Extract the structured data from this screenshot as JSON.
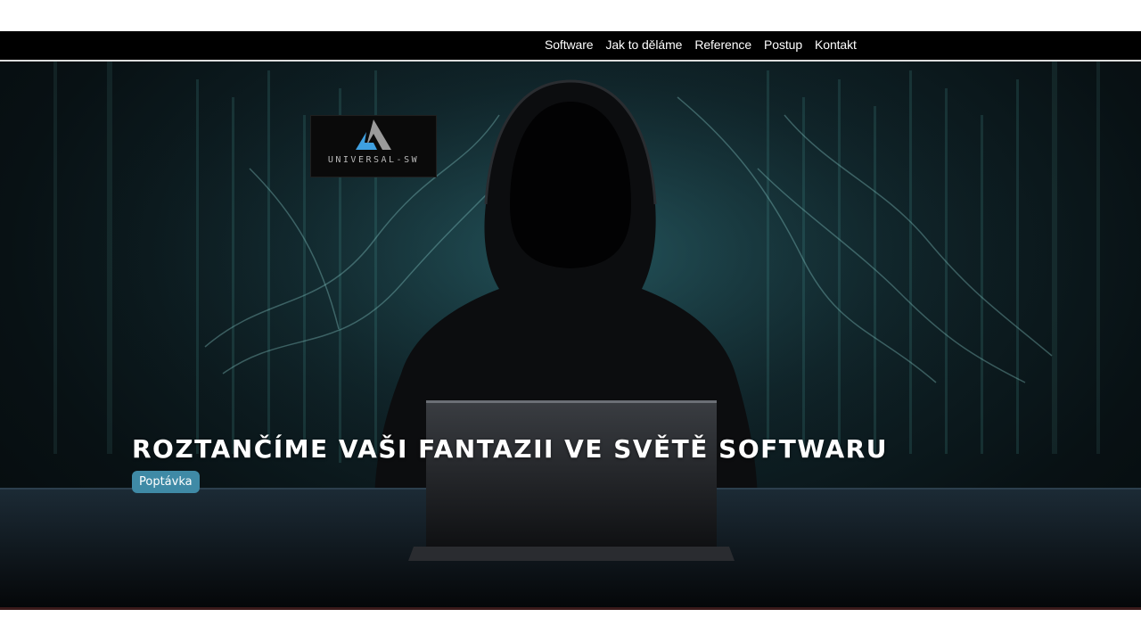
{
  "nav": {
    "items": [
      {
        "label": "Software"
      },
      {
        "label": "Jak to děláme"
      },
      {
        "label": "Reference"
      },
      {
        "label": "Postup"
      },
      {
        "label": "Kontakt"
      }
    ]
  },
  "brand": {
    "logo_text": "UNIVERSAL-SW"
  },
  "hero": {
    "headline": "ROZTANČÍME VAŠI FANTAZII VE SVĚTĚ SOFTWARU",
    "cta_label": "Poptávka",
    "image_icon": "hooded-figure-laptop-illustration"
  },
  "colors": {
    "nav_bg": "#000000",
    "cta_bg": "#3f8aa6",
    "hero_glow": "#1b3d44",
    "logo_blue": "#3fa0e0",
    "logo_grey": "#9a9a9a"
  }
}
